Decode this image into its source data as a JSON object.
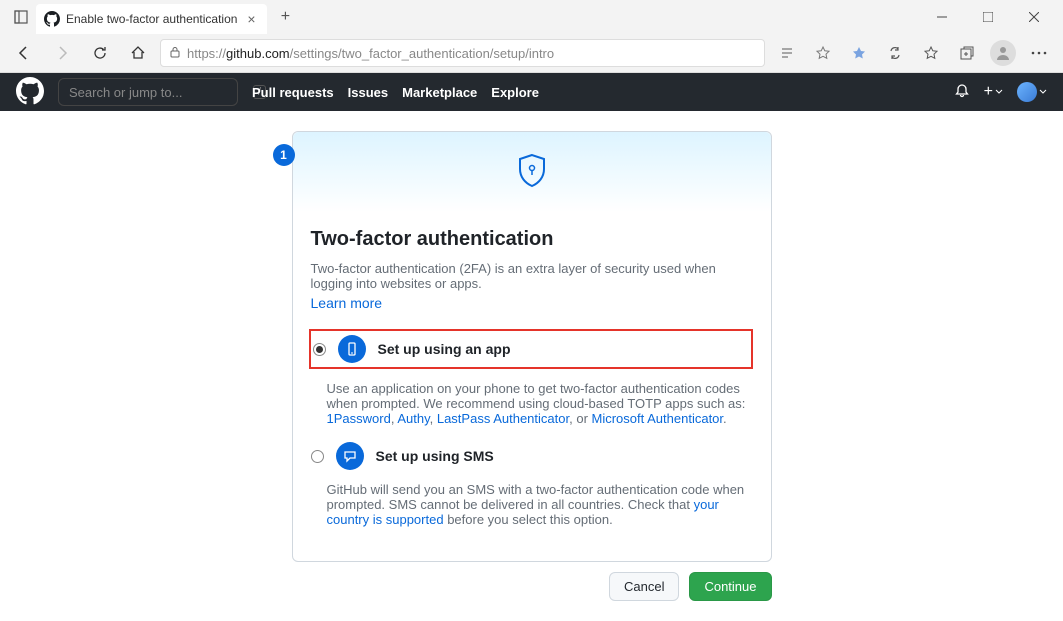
{
  "browser": {
    "tab_title": "Enable two-factor authentication",
    "url_protocol": "https://",
    "url_domain": "github.com",
    "url_path": "/settings/two_factor_authentication/setup/intro"
  },
  "gh_header": {
    "search_placeholder": "Search or jump to...",
    "nav": [
      "Pull requests",
      "Issues",
      "Marketplace",
      "Explore"
    ]
  },
  "setup": {
    "step": "1",
    "title": "Two-factor authentication",
    "description": "Two-factor authentication (2FA) is an extra layer of security used when logging into websites or apps.",
    "learn_more": "Learn more",
    "option_app": {
      "label": "Set up using an app",
      "desc_pre": "Use an application on your phone to get two-factor authentication codes when prompted. We recommend using cloud-based TOTP apps such as: ",
      "link1": "1Password",
      "link2": "Authy",
      "link3": "LastPass Authenticator",
      "sep_comma": ", ",
      "sep_or": ", or ",
      "link4": "Microsoft Authenticator",
      "desc_post": "."
    },
    "option_sms": {
      "label": "Set up using SMS",
      "desc_pre": "GitHub will send you an SMS with a two-factor authentication code when prompted. SMS cannot be delivered in all countries. Check that ",
      "link": "your country is supported",
      "desc_post": " before you select this option."
    },
    "cancel": "Cancel",
    "continue": "Continue"
  }
}
